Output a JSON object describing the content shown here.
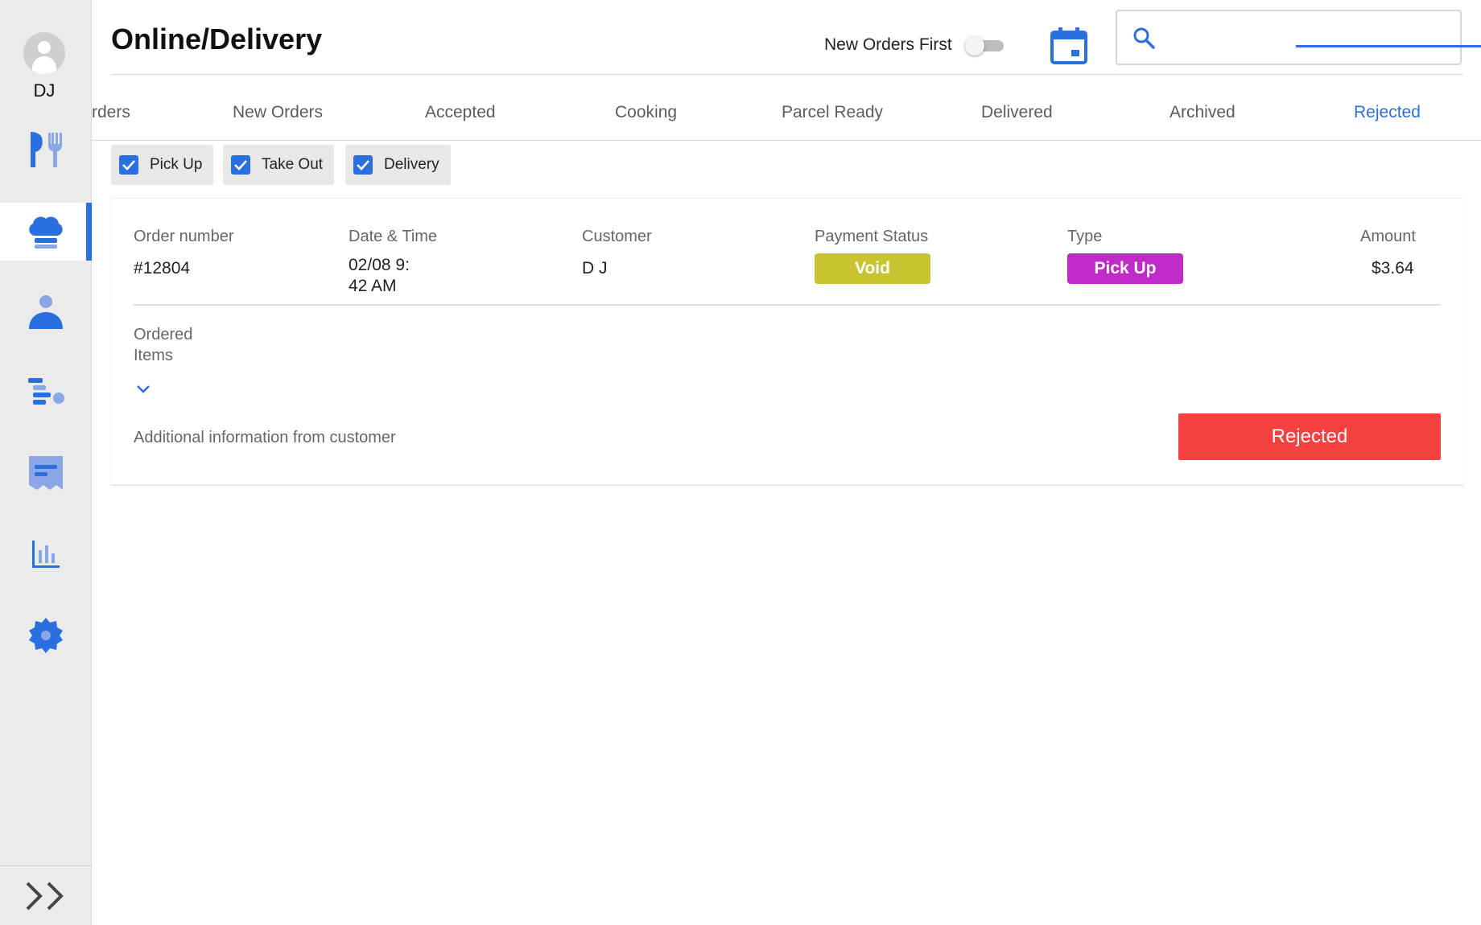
{
  "header": {
    "title": "Online/Delivery",
    "toggle_label": "New Orders First",
    "toggle_on": false,
    "search_value": "",
    "search_placeholder": ""
  },
  "sidebar": {
    "user_initials": "DJ",
    "items": [
      {
        "name": "menu",
        "icon": "utensils-icon"
      },
      {
        "name": "online-orders",
        "icon": "chef-hat-icon",
        "active": true
      },
      {
        "name": "customers",
        "icon": "person-icon"
      },
      {
        "name": "queue",
        "icon": "list-icon"
      },
      {
        "name": "receipts",
        "icon": "receipt-icon"
      },
      {
        "name": "reports",
        "icon": "bar-chart-icon"
      },
      {
        "name": "settings",
        "icon": "gear-icon"
      }
    ],
    "expand_icon": "double-chevron-right-icon"
  },
  "tabs": [
    {
      "label": "rders"
    },
    {
      "label": "New Orders"
    },
    {
      "label": "Accepted"
    },
    {
      "label": "Cooking"
    },
    {
      "label": "Parcel Ready"
    },
    {
      "label": "Delivered"
    },
    {
      "label": "Archived"
    },
    {
      "label": "Rejected",
      "active": true
    }
  ],
  "filters": [
    {
      "label": "Pick Up",
      "checked": true
    },
    {
      "label": "Take Out",
      "checked": true
    },
    {
      "label": "Delivery",
      "checked": true
    }
  ],
  "order": {
    "headers": {
      "order_number": "Order number",
      "date_time": "Date & Time",
      "customer": "Customer",
      "payment_status": "Payment Status",
      "type": "Type",
      "amount": "Amount"
    },
    "order_number": "#12804",
    "date_line1": "02/08 9:",
    "date_line2": "42 AM",
    "customer": "D J",
    "payment_status": "Void",
    "type": "Pick Up",
    "amount": "$3.64",
    "ordered_items_label": "Ordered Items",
    "additional_info_label": "Additional information from customer",
    "status_button": "Rejected"
  },
  "colors": {
    "accent": "#2a6fe0",
    "void_badge": "#c8c42f",
    "pickup_badge": "#c02ac8",
    "rejected_button": "#f4413f",
    "sidebar_bg": "#ebebeb"
  }
}
